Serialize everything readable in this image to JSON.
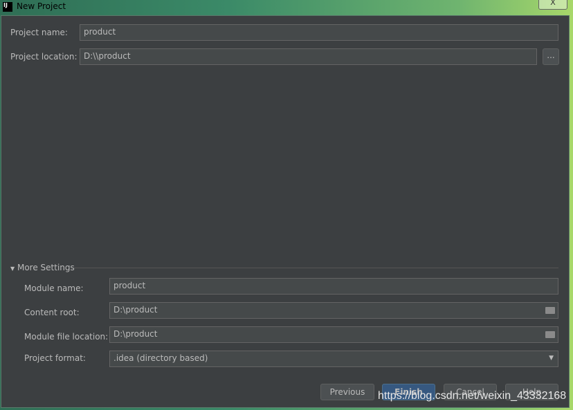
{
  "window": {
    "title": "New Project",
    "icon": "intellij-icon",
    "close": "X"
  },
  "form": {
    "project_name": {
      "label": "Project name:",
      "value": "product"
    },
    "project_location": {
      "label": "Project location:",
      "value": "D:\\\\product",
      "browse": "..."
    }
  },
  "more_settings": {
    "label": "More Settings",
    "module_name": {
      "label": "Module name:",
      "value": "product"
    },
    "content_root": {
      "label": "Content root:",
      "value": "D:\\product"
    },
    "module_file_location": {
      "label": "Module file location:",
      "value": "D:\\product"
    },
    "project_format": {
      "label": "Project format:",
      "value": ".idea (directory based)"
    }
  },
  "buttons": {
    "previous": "Previous",
    "finish": "Finish",
    "cancel": "Cancel",
    "help": "Help"
  },
  "watermark": "https://blog.csdn.net/weixin_43332168"
}
